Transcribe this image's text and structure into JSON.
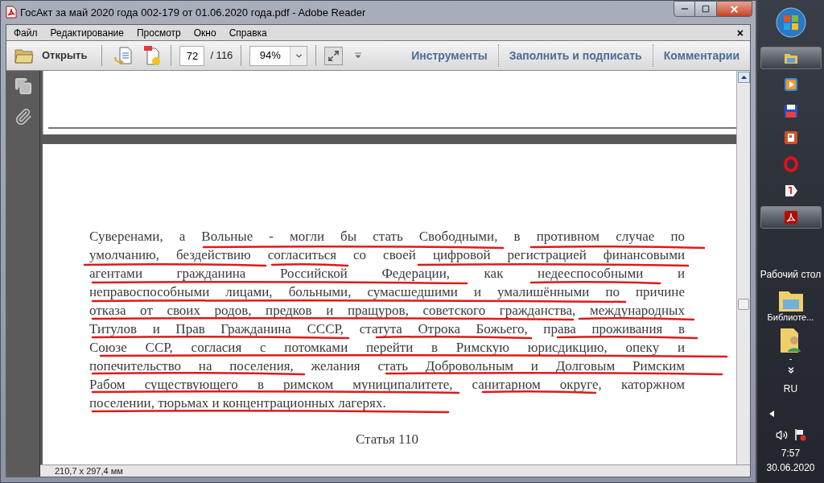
{
  "window": {
    "title": "ГосАкт за май 2020 года 002-179 от 01.06.2020 года.pdf - Adobe Reader"
  },
  "menu": [
    "Файл",
    "Редактирование",
    "Просмотр",
    "Окно",
    "Справка"
  ],
  "menu_close": "×",
  "toolbar": {
    "open_label": "Открыть",
    "page_value": "72",
    "page_total": "/ 116",
    "zoom_value": "94%"
  },
  "panel_links": [
    "Инструменты",
    "Заполнить и подписать",
    "Комментарии"
  ],
  "document": {
    "lines": [
      "Суверенами, а Вольные - могли бы стать Свободными, в противном случае по",
      "умолчанию, бездействию согласиться со своей цифровой регистрацией финансовыми",
      "агентами гражданина Российской Федерации, как недееспособными и",
      "неправоспособными лицами, больными, сумасшедшими и умалишёнными по причине",
      "отказа от своих родов, предков и пращуров, советского гражданства, международных",
      "Титулов и Прав Гражданина СССР, статута Отрока Божьего, права проживания в",
      "Союзе ССР, согласия с потомками перейти в Римскую юрисдикцию, опеку и",
      "попечительство на поселения, желания стать Добровольным и Долговым Римским",
      "Рабом существующего в римском муниципалитете, санитарном округе, каторжном",
      "поселении, тюрьмах и концентрационных лагерях."
    ],
    "heading": "Статья 110"
  },
  "status_bar": "210,7 x 297,4 мм",
  "taskbar": {
    "apps": [
      {
        "kind": "folder",
        "active": true
      },
      {
        "kind": "player",
        "active": false
      },
      {
        "kind": "floppy",
        "active": false
      },
      {
        "kind": "slides",
        "active": false
      },
      {
        "kind": "opera",
        "active": false
      },
      {
        "kind": "yandex",
        "active": false
      },
      {
        "kind": "pdf",
        "active": true
      }
    ],
    "toolbar_label": "Рабочий стол",
    "desktop_items": [
      {
        "kind": "library",
        "label": "Библиоте..."
      },
      {
        "kind": "user",
        "label": "-"
      }
    ],
    "language": "RU",
    "time": "7:57",
    "date": "30.06.2020"
  }
}
